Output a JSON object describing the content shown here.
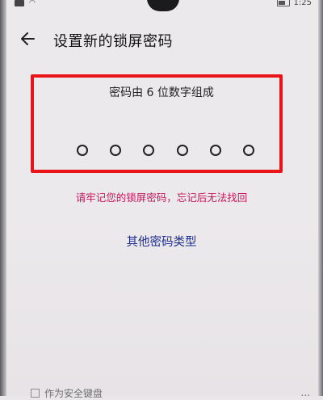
{
  "status_bar": {
    "time": "1:25",
    "signal_icon": "signal-icon",
    "wifi_icon": "wifi-icon",
    "battery_icon": "battery-icon"
  },
  "header": {
    "title": "设置新的锁屏密码",
    "back_icon": "back-arrow-icon"
  },
  "pin_entry": {
    "instruction": "密码由 6 位数字组成",
    "digit_count": 6,
    "filled": 0
  },
  "warning_text": "请牢记您的锁屏密码，忘记后无法找回",
  "other_types_label": "其他密码类型",
  "bottom": {
    "left_text": "作为安全键盘",
    "right_text": "..."
  },
  "colors": {
    "highlight_border": "#e8141a",
    "warning": "#c2185b",
    "link": "#1f2f8a"
  }
}
